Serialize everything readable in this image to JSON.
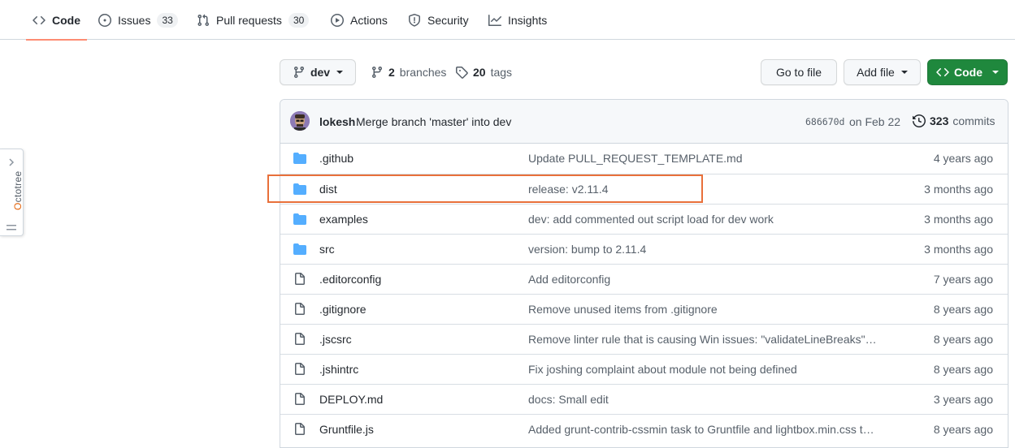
{
  "nav": {
    "tabs": [
      {
        "label": "Code",
        "count": ""
      },
      {
        "label": "Issues",
        "count": "33"
      },
      {
        "label": "Pull requests",
        "count": "30"
      },
      {
        "label": "Actions",
        "count": ""
      },
      {
        "label": "Security",
        "count": ""
      },
      {
        "label": "Insights",
        "count": ""
      }
    ]
  },
  "octotree": {
    "label_accent": "O",
    "label_rest": "ctotree"
  },
  "branch_bar": {
    "branch": "dev",
    "branches_count": "2",
    "branches_label": "branches",
    "tags_count": "20",
    "tags_label": "tags",
    "go_to_file": "Go to file",
    "add_file": "Add file",
    "code": "Code"
  },
  "commit": {
    "author": "lokesh",
    "message": "Merge branch 'master' into dev",
    "sha": "686670d",
    "date": "on Feb 22",
    "count": "323",
    "count_label": "commits"
  },
  "files": [
    {
      "type": "dir",
      "name": ".github",
      "message": "Update PULL_REQUEST_TEMPLATE.md",
      "age": "4 years ago"
    },
    {
      "type": "dir",
      "name": "dist",
      "message": "release: v2.11.4",
      "age": "3 months ago"
    },
    {
      "type": "dir",
      "name": "examples",
      "message": "dev: add commented out script load for dev work",
      "age": "3 months ago"
    },
    {
      "type": "dir",
      "name": "src",
      "message": "version: bump to 2.11.4",
      "age": "3 months ago"
    },
    {
      "type": "file",
      "name": ".editorconfig",
      "message": "Add editorconfig",
      "age": "7 years ago"
    },
    {
      "type": "file",
      "name": ".gitignore",
      "message": "Remove unused items from .gitignore",
      "age": "8 years ago"
    },
    {
      "type": "file",
      "name": ".jscsrc",
      "message": "Remove linter rule that is causing Win issues: \"validateLineBreaks\": ...",
      "age": "8 years ago"
    },
    {
      "type": "file",
      "name": ".jshintrc",
      "message": "Fix joshing complaint about module not being defined",
      "age": "8 years ago"
    },
    {
      "type": "file",
      "name": "DEPLOY.md",
      "message": "docs: Small edit",
      "age": "3 years ago"
    },
    {
      "type": "file",
      "name": "Gruntfile.js",
      "message": "Added grunt-contrib-cssmin task to Gruntfile and lightbox.min.css to ...",
      "age": "8 years ago"
    }
  ],
  "colors": {
    "folder": "#54aeff",
    "file_icon": "#57606a",
    "accent_underline": "#fd8c73",
    "code_button": "#1f883d",
    "annotation": "#e8703a"
  }
}
